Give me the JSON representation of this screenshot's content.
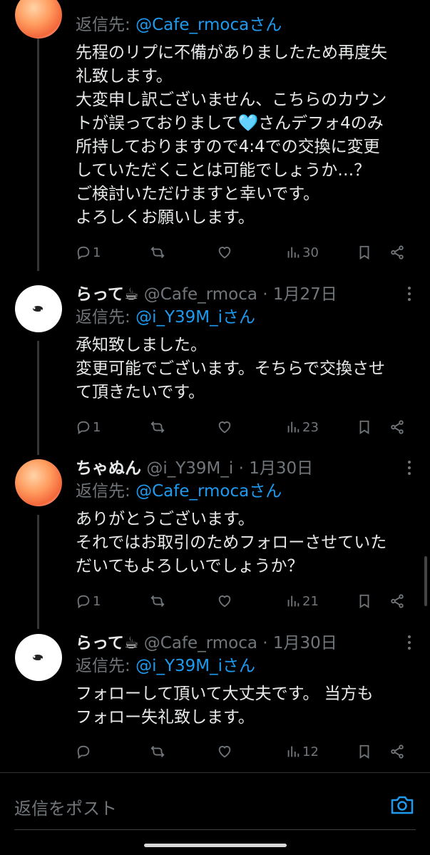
{
  "tweets": [
    {
      "reply_to_label": "返信先:",
      "reply_to_handle": "@Cafe_rmocaさん",
      "body": "先程のリプに不備がありましたため再度失\n礼致します。\n大変申し訳ございません、こちらのカウン\nトが誤っておりまして🩵さんデフォ4のみ\n所持しておりますので4:4での交換に変更\nしていただくことは可能でしょうか…？\nご検討いただけますと幸いです。\nよろしくお願いします。",
      "replies": "1",
      "retweets": "",
      "likes": "",
      "views": "30"
    },
    {
      "name": "らって☕",
      "handle": "@Cafe_rmoca",
      "date": "· 1月27日",
      "reply_to_label": "返信先:",
      "reply_to_handle": "@i_Y39M_iさん",
      "body": "承知致しました。\n変更可能でございます。そちらで交換させ\nて頂きたいです。",
      "replies": "1",
      "views": "23"
    },
    {
      "name": "ちゃぬん",
      "handle": "@i_Y39M_i",
      "date": "· 1月30日",
      "reply_to_label": "返信先:",
      "reply_to_handle": "@Cafe_rmocaさん",
      "body": "ありがとうございます。\nそれではお取引のためフォローさせていた\nだいてもよろしいでしょうか？",
      "replies": "1",
      "views": "21"
    },
    {
      "name": "らって☕",
      "handle": "@Cafe_rmoca",
      "date": "· 1月30日",
      "reply_to_label": "返信先:",
      "reply_to_handle": "@i_Y39M_iさん",
      "body": "フォローして頂いて大丈夫です。 当方も\nフォロー失礼致します。",
      "replies": "",
      "views": "12"
    }
  ],
  "composer": {
    "placeholder": "返信をポスト"
  },
  "icons": [
    "reply-icon",
    "retweet-icon",
    "like-icon",
    "views-icon",
    "bookmark-icon",
    "share-icon",
    "more-icon",
    "camera-icon"
  ],
  "colors": {
    "background": "#000000",
    "text": "#e7e9ea",
    "muted": "#71767b",
    "link": "#1d9bf0"
  }
}
